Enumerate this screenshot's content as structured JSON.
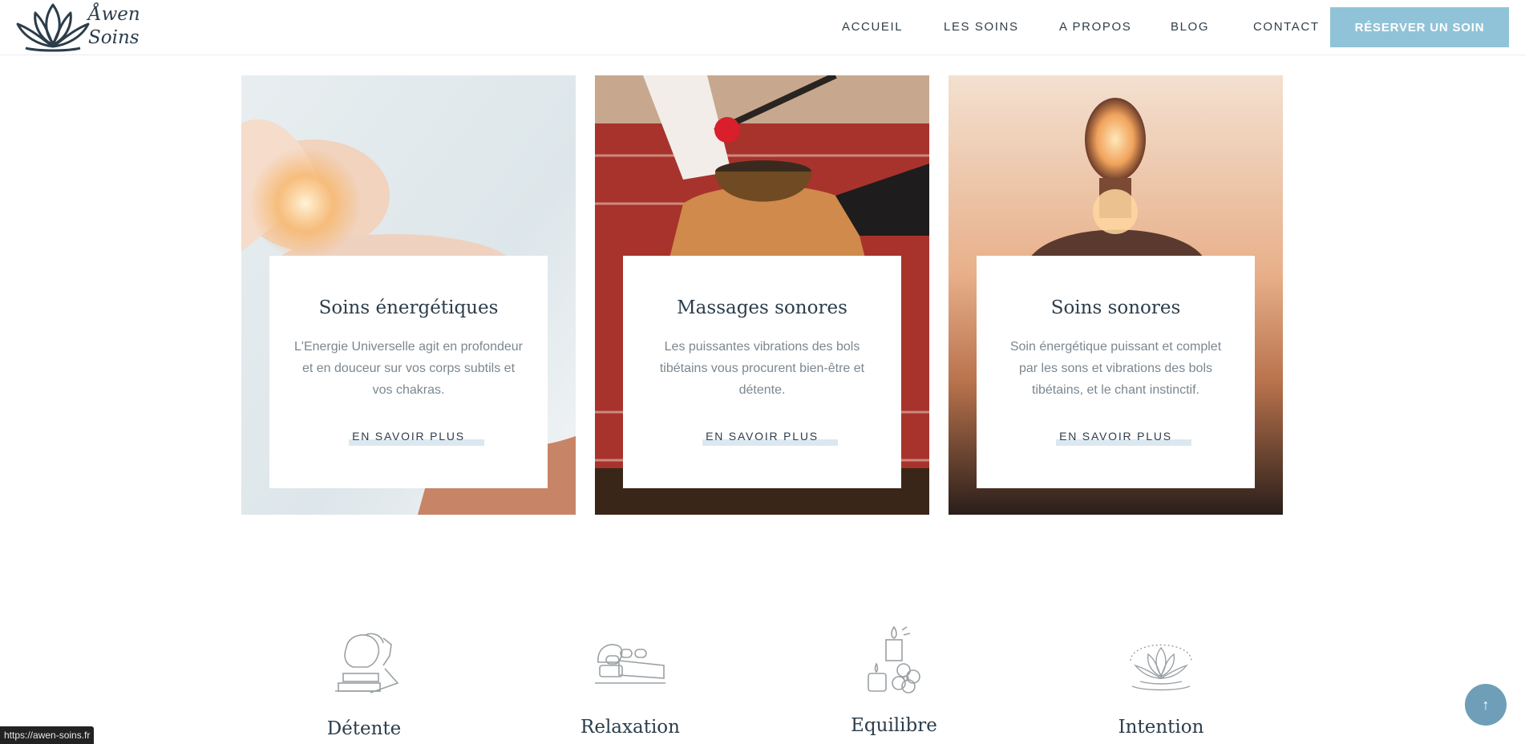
{
  "header": {
    "logo_text_line1": "Åwen",
    "logo_text_line2": "Soins",
    "nav": [
      {
        "label": "ACCUEIL"
      },
      {
        "label": "LES SOINS"
      },
      {
        "label": "A PROPOS"
      },
      {
        "label": "BLOG"
      },
      {
        "label": "CONTACT"
      }
    ],
    "cta_label": "RÉSERVER UN SOIN",
    "colors": {
      "accent": "#90c3d8",
      "highlight": "#dce8ef",
      "text": "#2f3e48"
    }
  },
  "cards": [
    {
      "title": "Soins énergétiques",
      "description": "L'Energie Universelle agit en profondeur et en douceur sur vos corps subtils et vos chakras.",
      "link": "EN SAVOIR PLUS"
    },
    {
      "title": "Massages sonores",
      "description": "Les puissantes vibrations des bols tibétains vous procurent bien-être et détente.",
      "link": "EN SAVOIR PLUS"
    },
    {
      "title": "Soins sonores",
      "description": "Soin énergétique puissant et complet par les sons et vibrations des bols tibétains, et le chant instinctif.",
      "link": "EN SAVOIR PLUS"
    }
  ],
  "features": [
    {
      "label": "Détente",
      "icon": "head-massage-icon"
    },
    {
      "label": "Relaxation",
      "icon": "hot-stones-icon"
    },
    {
      "label": "Equilibre",
      "icon": "candle-flower-icon"
    },
    {
      "label": "Intention",
      "icon": "lotus-icon"
    }
  ],
  "scroll_top_icon": "↑",
  "status_bar_url": "https://awen-soins.fr"
}
